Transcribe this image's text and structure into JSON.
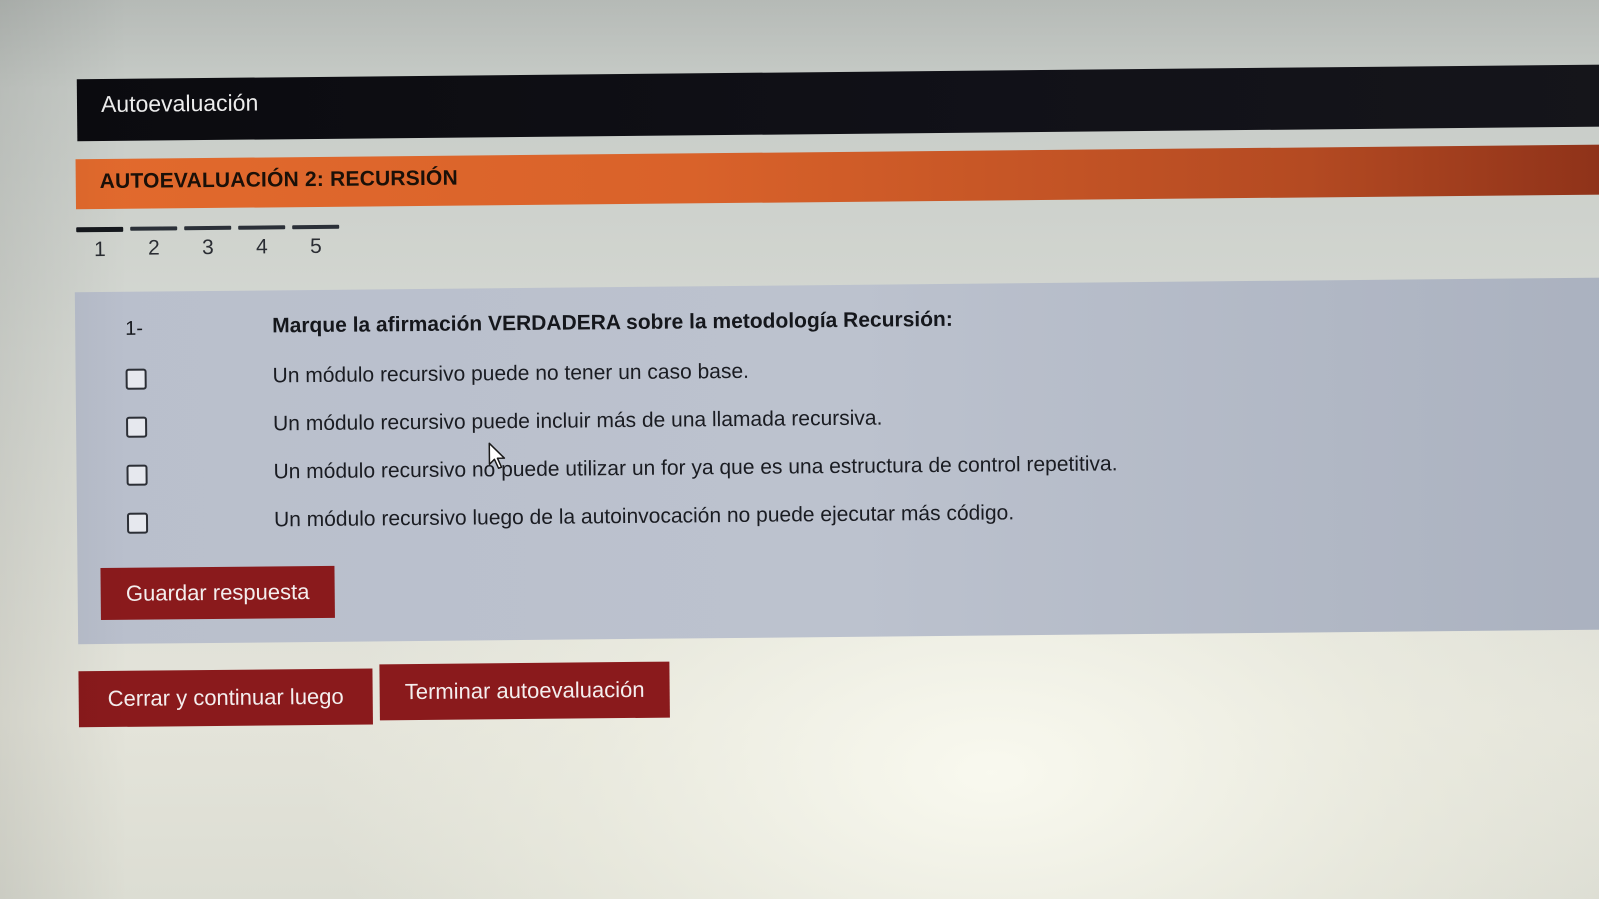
{
  "window": {
    "title": "Autoevaluación"
  },
  "section": {
    "title": "AUTOEVALUACIÓN 2: RECURSIÓN"
  },
  "pager": {
    "pages": [
      "1",
      "2",
      "3",
      "4",
      "5"
    ],
    "current": "1"
  },
  "question": {
    "number": "1-",
    "text": "Marque la afirmación VERDADERA sobre la metodología Recursión:",
    "options": [
      {
        "label": "Un módulo recursivo puede no tener un caso base.",
        "checked": false
      },
      {
        "label": "Un módulo recursivo puede incluir más de una llamada recursiva.",
        "checked": false
      },
      {
        "label": "Un módulo recursivo no puede utilizar un for ya que es una estructura de control repetitiva.",
        "checked": false
      },
      {
        "label": "Un módulo recursivo luego de la autoinvocación no puede ejecutar más código.",
        "checked": false
      }
    ],
    "save_label": "Guardar respuesta"
  },
  "actions": {
    "close_label": "Cerrar y continuar luego",
    "finish_label": "Terminar autoevaluación"
  },
  "colors": {
    "titlebar": "#0b0b0f",
    "banner": "#e26a2d",
    "panel": "#bcc2ce",
    "button": "#8a1a1c"
  },
  "icons": {
    "cursor": "mouse-pointer-icon",
    "checkbox": "checkbox-icon"
  }
}
